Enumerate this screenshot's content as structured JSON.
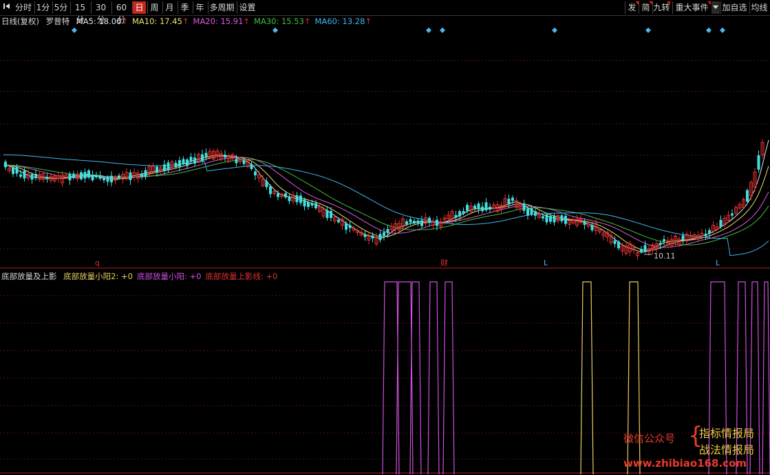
{
  "toolbar": {
    "nav_icon": "collapse-arrow-icon",
    "periods": [
      "分时",
      "1分",
      "5分",
      "15分",
      "30分",
      "60分",
      "日",
      "周",
      "月",
      "季",
      "年",
      "多周期",
      "设置"
    ],
    "active_period": "日",
    "right_items": [
      "发",
      "简",
      "九转",
      "重大事件",
      "加自选",
      "均线"
    ],
    "dropdown_icon": "dropdown-arrow-icon"
  },
  "main_legend": {
    "period_label": "日线(复权)",
    "indicator_name": "罗普特",
    "ma": [
      {
        "label": "MA5: 18.06",
        "color": "#e8e8e8"
      },
      {
        "label": "MA10: 17.45",
        "color": "#f0e070"
      },
      {
        "label": "MA20: 15.91",
        "color": "#e05ae0"
      },
      {
        "label": "MA30: 15.53",
        "color": "#40c040"
      },
      {
        "label": "MA60: 13.28",
        "color": "#40b8f0"
      }
    ],
    "up_arrow": "↑"
  },
  "sub_legend": {
    "title": "底部放量及上影",
    "items": [
      {
        "label": "底部放量小阳2: +0",
        "color": "#e8d060"
      },
      {
        "label": "底部放量小阳: +0",
        "color": "#d050e0"
      },
      {
        "label": "底部放量上影线: +0",
        "color": "#e03030"
      }
    ]
  },
  "markers": {
    "low_price_label": "10.11",
    "bottom_labels": [
      "q",
      "财",
      "L",
      "L"
    ]
  },
  "watermark": {
    "wechat": "微信公众号",
    "brace": "{",
    "line1": "指标情报局",
    "line2": "战法情报局",
    "url": "www.zhibiao168.com"
  },
  "chart_data": [
    {
      "type": "candlestick",
      "title": "日线(复权)",
      "description_series": [
        "MA5",
        "MA10",
        "MA20",
        "MA30",
        "MA60"
      ],
      "series": [
        {
          "name": "MA5",
          "color": "#e8e8e8",
          "last": 18.06
        },
        {
          "name": "MA10",
          "color": "#f0e070",
          "last": 17.45
        },
        {
          "name": "MA20",
          "color": "#e05ae0",
          "last": 15.91
        },
        {
          "name": "MA30",
          "color": "#40c040",
          "last": 15.53
        },
        {
          "name": "MA60",
          "color": "#40b8f0",
          "last": 13.28
        }
      ],
      "annotations": [
        "10.11"
      ],
      "grid": true
    },
    {
      "type": "line",
      "series": [
        {
          "name": "底部放量小阳2",
          "color": "#e8d060",
          "value": 0
        },
        {
          "name": "底部放量小阳",
          "color": "#d050e0",
          "value": 0
        },
        {
          "name": "底部放量上影线",
          "color": "#e03030",
          "value": 0
        }
      ],
      "grid": true
    }
  ]
}
